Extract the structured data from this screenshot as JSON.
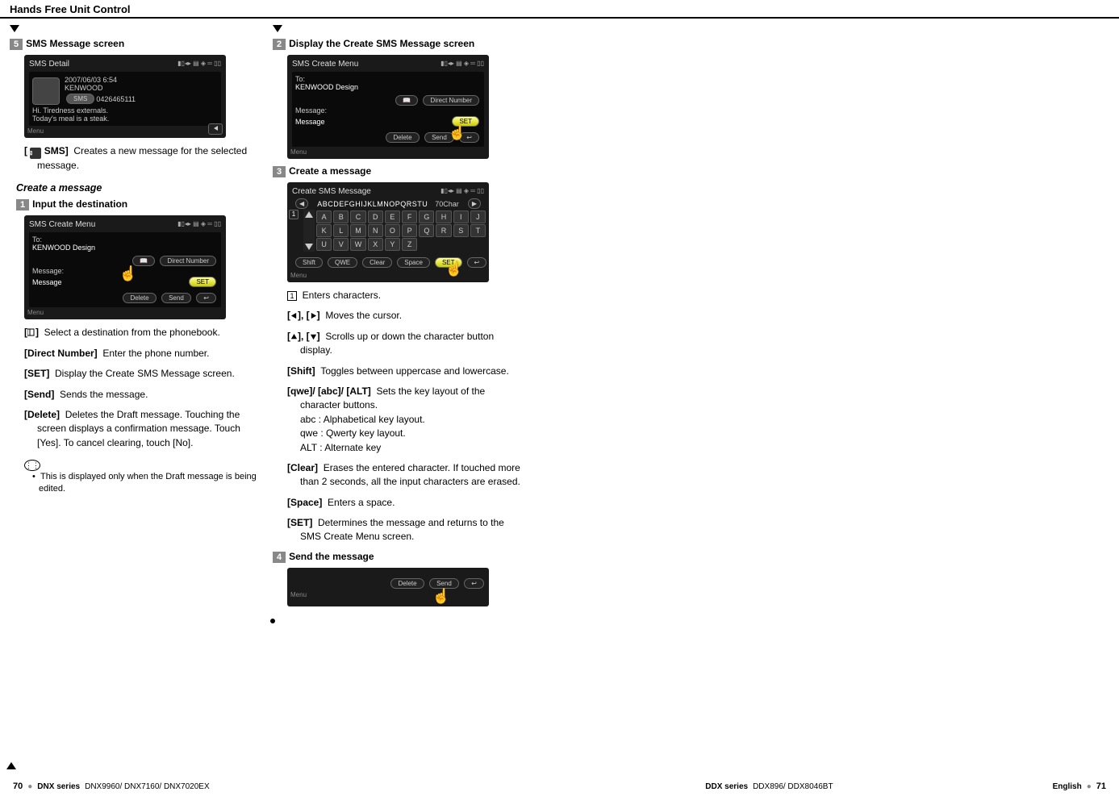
{
  "header": "Hands Free Unit Control",
  "col1": {
    "step5_num": "5",
    "step5_label": "SMS Message screen",
    "screenshot_detail": {
      "title": "SMS Detail",
      "dt": "2007/06/03 6:54",
      "name": "KENWOOD",
      "num": "0426465111",
      "badge": "SMS",
      "body1": "Hi. Tiredness externals.",
      "body2": "Today's meal is a steak.",
      "bottom": "Menu"
    },
    "sms_label": "SMS]",
    "sms_text": "Creates a new message for the selected message.",
    "section_sub": "Create a message",
    "step1_num": "1",
    "step1_label": "Input the destination",
    "screenshot_create": {
      "title": "SMS Create Menu",
      "to_label": "To:",
      "to_val": "KENWOOD Design",
      "direct": "Direct Number",
      "msg_label": "Message:",
      "msg_val": "Message",
      "set": "SET",
      "del": "Delete",
      "send": "Send",
      "bottom": "Menu"
    },
    "pb_label": "]",
    "pb_text": "Select a destination from the phonebook.",
    "direct_label": "[Direct Number]",
    "direct_text": "Enter the phone number.",
    "set_label": "[SET]",
    "set_text": "Display the Create SMS Message screen.",
    "send_label": "[Send]",
    "send_text": "Sends the message.",
    "del_label": "[Delete]",
    "del_text": "Deletes the Draft message. Touching the screen displays a confirmation message. Touch [Yes]. To cancel clearing, touch [No].",
    "note": "This is displayed only when the Draft message is being edited."
  },
  "col2": {
    "step2_num": "2",
    "step2_label": "Display the Create SMS Message screen",
    "step3_num": "3",
    "step3_label": "Create a message",
    "screenshot_key": {
      "title": "Create SMS Message",
      "charseq": "ABCDEFGHIJKLMNOPQRSTU",
      "countlabel": "70Char",
      "row1": [
        "A",
        "B",
        "C",
        "D",
        "E",
        "F",
        "G",
        "H",
        "I",
        "J"
      ],
      "row2": [
        "K",
        "L",
        "M",
        "N",
        "O",
        "P",
        "Q",
        "R",
        "S",
        "T"
      ],
      "row3": [
        "U",
        "V",
        "W",
        "X",
        "Y",
        "Z"
      ],
      "shift": "Shift",
      "qwe": "QWE",
      "clear": "Clear",
      "space": "Space",
      "set": "SET",
      "bottom": "Menu"
    },
    "d1_num": "1",
    "d1_text": "Enters characters.",
    "d2_label": "], [",
    "d2_label_end": "]",
    "d2_text": "Moves the cursor.",
    "d3_label": "], [",
    "d3_label_end": "]",
    "d3_text": "Scrolls up or down the character button display.",
    "d4_label": "[Shift]",
    "d4_text": "Toggles between uppercase and lowercase.",
    "d5_label": "[qwe]/ [abc]/ [ALT]",
    "d5_text": "Sets the key layout of the character buttons.",
    "d5_a": "abc : Alphabetical key layout.",
    "d5_b": "qwe : Qwerty key layout.",
    "d5_c": "ALT : Alternate key",
    "d6_label": "[Clear]",
    "d6_text": "Erases the entered character. If touched more than 2 seconds, all the input characters are erased.",
    "d7_label": "[Space]",
    "d7_text": "Enters a space.",
    "d8_label": "[SET]",
    "d8_text": "Determines the message and returns to the SMS Create Menu screen.",
    "step4_num": "4",
    "step4_label": "Send the message",
    "screenshot_send": {
      "del": "Delete",
      "send": "Send",
      "bottom": "Menu"
    }
  },
  "footer": {
    "pg_l": "70",
    "dnx_l": "DNX series",
    "dnx_v": "DNX9960/ DNX7160/ DNX7020EX",
    "ddx_l": "DDX series",
    "ddx_v": "DDX896/ DDX8046BT",
    "eng": "English",
    "pg_r": "71"
  }
}
